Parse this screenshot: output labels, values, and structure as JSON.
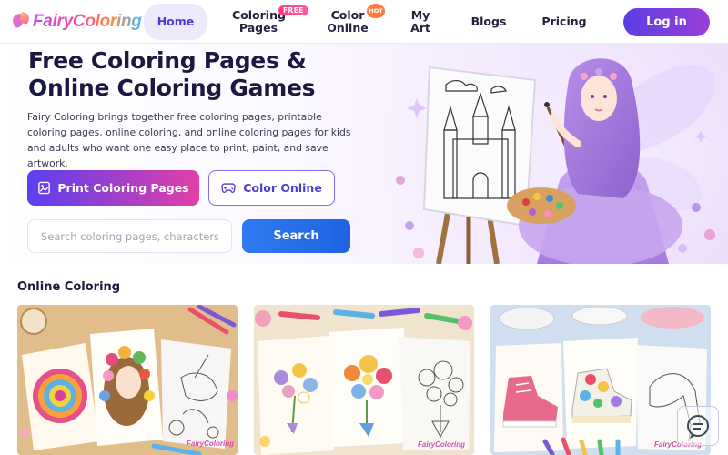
{
  "brand": {
    "name": "FairyColoring"
  },
  "nav": {
    "home": "Home",
    "coloring_pages": "Coloring Pages",
    "free_badge": "FREE",
    "color_online": "Color Online",
    "hot_badge": "HOT",
    "my_art": "My Art",
    "blogs": "Blogs",
    "pricing": "Pricing",
    "login": "Log in"
  },
  "hero": {
    "title": "Free Coloring Pages & Online Coloring Games",
    "description": "Fairy Coloring brings together free coloring pages, printable coloring pages, online coloring, and online coloring pages for kids and adults who want one easy place to print, paint, and save artwork.",
    "print_button": "Print Coloring Pages",
    "color_button": "Color Online",
    "search_placeholder": "Search coloring pages, characters,",
    "search_value": "",
    "search_button": "Search"
  },
  "section": {
    "title": "Online Coloring"
  },
  "cards": [
    {
      "watermark": "FairyColoring"
    },
    {
      "watermark": "FairyColoring"
    },
    {
      "watermark": "FairyColoring"
    }
  ],
  "colors": {
    "accent": "#5b3de6",
    "pink": "#e23fa7",
    "search_blue": "#2f7bf2",
    "home_pill": "#ece9fb"
  },
  "icons": {
    "logo": "fairy-wings-icon",
    "print": "print-image-icon",
    "color_online": "gamepad-icon",
    "help": "chat-help-icon"
  }
}
